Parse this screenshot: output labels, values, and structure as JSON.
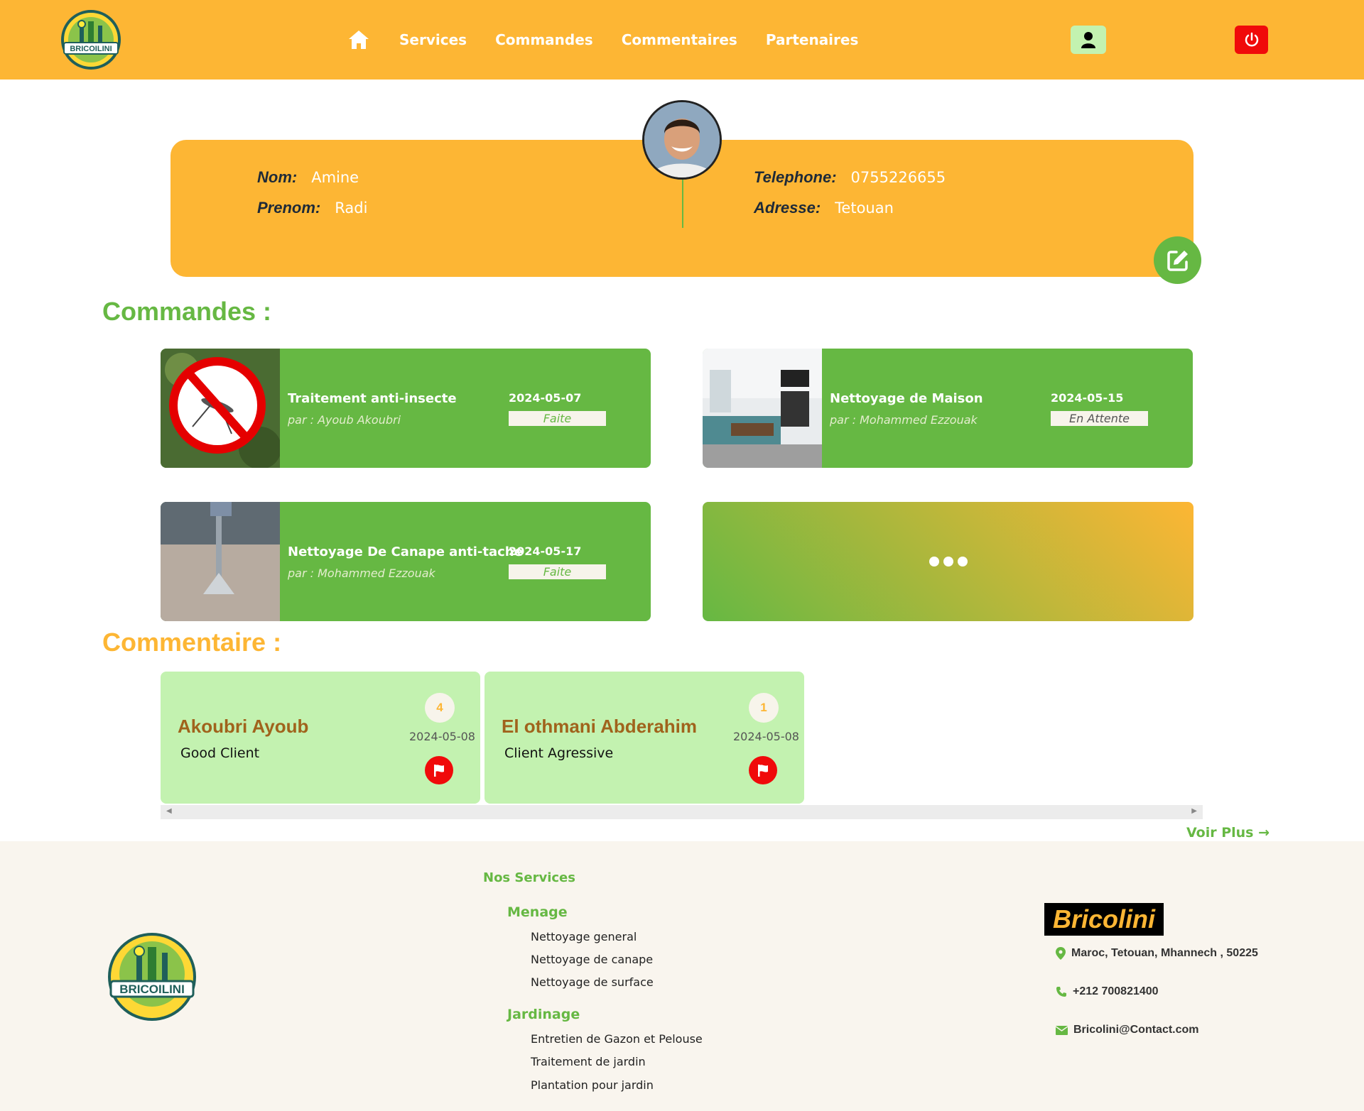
{
  "header": {
    "logo_text": "BRICOILINI",
    "nav": [
      "Services",
      "Commandes",
      "Commentaires",
      "Partenaires"
    ]
  },
  "profile": {
    "nom_label": "Nom:",
    "nom": "Amine",
    "prenom_label": "Prenom:",
    "prenom": "Radi",
    "tel_label": "Telephone:",
    "telephone": "0755226655",
    "adresse_label": "Adresse:",
    "adresse": "Tetouan"
  },
  "commandes": {
    "title": "Commandes :",
    "orders": [
      {
        "title": "Traitement anti-insecte",
        "by": "par : Ayoub Akoubri",
        "date": "2024-05-07",
        "status": "Faite"
      },
      {
        "title": "Nettoyage de Maison",
        "by": "par : Mohammed Ezzouak",
        "date": "2024-05-15",
        "status": "En Attente"
      },
      {
        "title": "Nettoyage De Canape anti-tache",
        "by": "par : Mohammed Ezzouak",
        "date": "2024-05-17",
        "status": "Faite"
      }
    ]
  },
  "commentaires": {
    "title": "Commentaire :",
    "items": [
      {
        "name": "Akoubri Ayoub",
        "text": "Good Client",
        "rating": "4",
        "date": "2024-05-08"
      },
      {
        "name": "El othmani Abderahim",
        "text": "Client Agressive",
        "rating": "1",
        "date": "2024-05-08"
      }
    ],
    "voir_plus": "Voir Plus"
  },
  "footer": {
    "nos_services": "Nos Services",
    "menage": "Menage",
    "menage_items": [
      "Nettoyage general",
      "Nettoyage de canape",
      "Nettoyage de surface"
    ],
    "jardinage": "Jardinage",
    "jardinage_items": [
      "Entretien de Gazon et Pelouse",
      "Traitement de jardin",
      "Plantation pour jardin"
    ],
    "brand": "Bricolini",
    "address": "Maroc, Tetouan, Mhannech , 50225",
    "phone": "+212 700821400",
    "email": "Bricolini@Contact.com"
  },
  "colors": {
    "orange": "#fdb634",
    "green": "#66b843",
    "light_green": "#c3f2b0",
    "red": "#f00a0a",
    "footer_bg": "#f9f5ee"
  }
}
